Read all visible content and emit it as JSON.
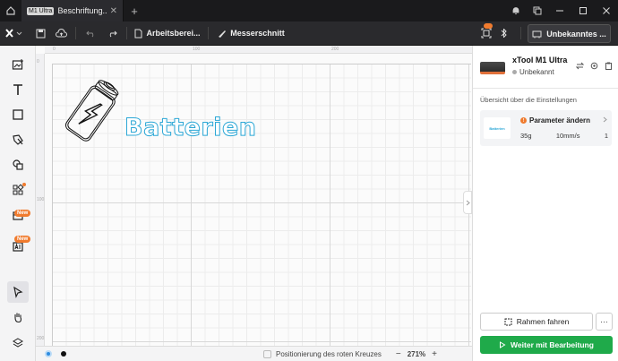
{
  "titlebar": {
    "tab_badge": "M1 Ultra",
    "tab_title": "Beschriftung...",
    "tab_close": "✕",
    "tab_add": "+"
  },
  "toolbar": {
    "workspace_label": "Arbeitsberei...",
    "cut_label": "Messerschnitt",
    "device_button_label": "Unbekanntes ..."
  },
  "sidebar": {
    "new_badge_1": "New",
    "new_badge_2": "New"
  },
  "canvas": {
    "ruler_top": [
      "0",
      "100",
      "200"
    ],
    "ruler_left": [
      "0",
      "100",
      "200"
    ],
    "design_text": "Batterien"
  },
  "statusbar": {
    "positioning_label": "Positionierung des roten Kreuzes",
    "zoom_minus": "−",
    "zoom_value": "271%",
    "zoom_plus": "+"
  },
  "device": {
    "name": "xTool M1 Ultra",
    "status": "Unbekannt"
  },
  "panel": {
    "overview_label": "Übersicht über die Einstellungen",
    "param_title": "Parameter ändern",
    "param_thumb_text": "Batterien",
    "param_pressure": "35g",
    "param_speed": "10mm/s",
    "param_passes": "1",
    "frame_button": "Rahmen fahren",
    "more_button": "···",
    "continue_button": "Weiter mit Bearbeitung"
  },
  "colors": {
    "accent_green": "#1faa4a",
    "text_outline_blue": "#2ba7d6",
    "badge_orange": "#f07b2e"
  }
}
